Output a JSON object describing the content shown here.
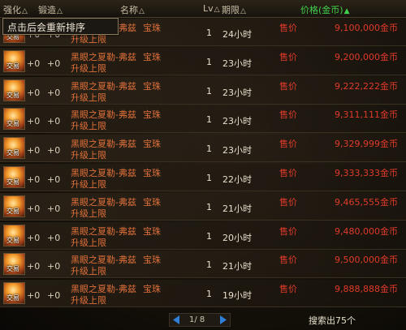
{
  "header": {
    "enhance": "强化",
    "refine": "锻造",
    "name": "名称",
    "lv": "Lv",
    "period": "期限",
    "price": "价格(金币)",
    "sort_arrow": "△",
    "active_arrow": "▲"
  },
  "tooltip": "点击后会重新排序",
  "item_icon_tag": "交易",
  "rows": [
    {
      "enhance": "+0",
      "refine": "+0",
      "name_line1": "黑眼之夏勒-弗兹",
      "name_line2": "升级上限",
      "kind": "宝珠",
      "lv": "1",
      "period": "24小时",
      "price_label": "售价",
      "price": "9,100,000金币"
    },
    {
      "enhance": "+0",
      "refine": "+0",
      "name_line1": "黑眼之夏勒-弗兹",
      "name_line2": "升级上限",
      "kind": "宝珠",
      "lv": "1",
      "period": "23小时",
      "price_label": "售价",
      "price": "9,200,000金币"
    },
    {
      "enhance": "+0",
      "refine": "+0",
      "name_line1": "黑眼之夏勒-弗兹",
      "name_line2": "升级上限",
      "kind": "宝珠",
      "lv": "1",
      "period": "23小时",
      "price_label": "售价",
      "price": "9,222,222金币"
    },
    {
      "enhance": "+0",
      "refine": "+0",
      "name_line1": "黑眼之夏勒-弗兹",
      "name_line2": "升级上限",
      "kind": "宝珠",
      "lv": "1",
      "period": "23小时",
      "price_label": "售价",
      "price": "9,311,111金币"
    },
    {
      "enhance": "+0",
      "refine": "+0",
      "name_line1": "黑眼之夏勒-弗兹",
      "name_line2": "升级上限",
      "kind": "宝珠",
      "lv": "1",
      "period": "23小时",
      "price_label": "售价",
      "price": "9,329,999金币"
    },
    {
      "enhance": "+0",
      "refine": "+0",
      "name_line1": "黑眼之夏勒-弗兹",
      "name_line2": "升级上限",
      "kind": "宝珠",
      "lv": "1",
      "period": "22小时",
      "price_label": "售价",
      "price": "9,333,333金币"
    },
    {
      "enhance": "+0",
      "refine": "+0",
      "name_line1": "黑眼之夏勒-弗兹",
      "name_line2": "升级上限",
      "kind": "宝珠",
      "lv": "1",
      "period": "21小时",
      "price_label": "售价",
      "price": "9,465,555金币"
    },
    {
      "enhance": "+0",
      "refine": "+0",
      "name_line1": "黑眼之夏勒-弗兹",
      "name_line2": "升级上限",
      "kind": "宝珠",
      "lv": "1",
      "period": "20小时",
      "price_label": "售价",
      "price": "9,480,000金币"
    },
    {
      "enhance": "+0",
      "refine": "+0",
      "name_line1": "黑眼之夏勒-弗兹",
      "name_line2": "升级上限",
      "kind": "宝珠",
      "lv": "1",
      "period": "21小时",
      "price_label": "售价",
      "price": "9,500,000金币"
    },
    {
      "enhance": "+0",
      "refine": "+0",
      "name_line1": "黑眼之夏勒-弗兹",
      "name_line2": "升级上限",
      "kind": "宝珠",
      "lv": "1",
      "period": "19小时",
      "price_label": "售价",
      "price": "9,888,888金币"
    }
  ],
  "pager": {
    "text": "1/ 8"
  },
  "search_count": "搜索出75个",
  "colors": {
    "price": "#e03a2a",
    "item_name": "#e0703a",
    "active_sort": "#3fd14a",
    "pager_arrow": "#2f7fd8"
  },
  "icons": {
    "prev": "triangle-left-icon",
    "next": "triangle-right-icon",
    "item": "orb-item-icon"
  }
}
